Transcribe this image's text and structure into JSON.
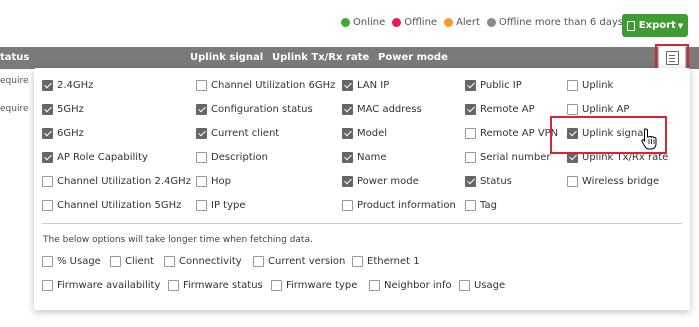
{
  "legend": {
    "online": "Online",
    "offline": "Offline",
    "alert": "Alert",
    "offline_long": "Offline more than 6 days"
  },
  "colors": {
    "online": "#3dae2b",
    "offline": "#e31b54",
    "alert": "#f59a23",
    "offline_long": "#8a8a8a",
    "export_button": "#3f9c35",
    "highlight": "#d8262e"
  },
  "export_label": "Export",
  "table": {
    "headers": [
      "tatus",
      "Uplink signal",
      "Uplink Tx/Rx rate",
      "Power mode"
    ],
    "rows": [
      "equire",
      "equire"
    ]
  },
  "options": {
    "col1": [
      "2.4GHz",
      "5GHz",
      "6GHz",
      "AP Role Capability",
      "Channel Utilization 2.4GHz",
      "Channel Utilization 5GHz"
    ],
    "col2": [
      "Channel Utilization 6GHz",
      "Configuration status",
      "Current client",
      "Description",
      "Hop",
      "IP type"
    ],
    "col3": [
      "LAN IP",
      "MAC address",
      "Model",
      "Name",
      "Power mode",
      "Product information"
    ],
    "col4": [
      "Public IP",
      "Remote AP",
      "Remote AP VPN",
      "Serial number",
      "Status",
      "Tag"
    ],
    "col5": [
      "Uplink",
      "Uplink AP",
      "Uplink signal",
      "Uplink Tx/Rx rate",
      "Wireless bridge"
    ]
  },
  "slow_note": "The below options will take longer time when fetching data.",
  "slow_options": {
    "row1": [
      "% Usage",
      "Client",
      "Connectivity",
      "Current version",
      "Ethernet 1"
    ],
    "row2": [
      "Firmware availability",
      "Firmware status",
      "Firmware type",
      "Neighbor info",
      "Usage"
    ]
  }
}
